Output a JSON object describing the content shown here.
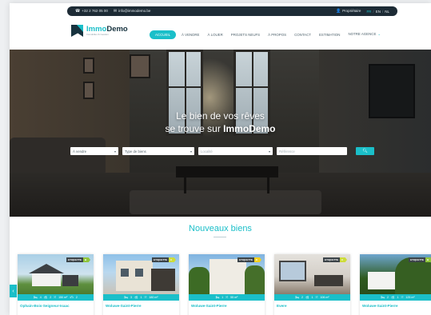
{
  "topbar": {
    "phone": "+32 2 762 05 00",
    "email": "info@immodemo.be",
    "owners": "Propriétaire",
    "langs": [
      {
        "code": "FR",
        "active": true
      },
      {
        "code": "EN",
        "active": false
      },
      {
        "code": "NL",
        "active": false
      }
    ],
    "lang_sep": "/"
  },
  "logo": {
    "name_part1": "Immo",
    "name_part2": "Demo",
    "tagline": "Immobilier & Gestion"
  },
  "nav": {
    "items": [
      {
        "label": "Accueil",
        "active": true
      },
      {
        "label": "À vendre"
      },
      {
        "label": "À louer"
      },
      {
        "label": "Projets neufs"
      },
      {
        "label": "À propos"
      },
      {
        "label": "Contact"
      },
      {
        "label": "Estimation"
      },
      {
        "label": "Notre agence"
      }
    ]
  },
  "hero": {
    "line1": "Le bien de vos rêves",
    "line2_prefix": "se trouve sur ",
    "line2_brand": "ImmoDemo"
  },
  "search": {
    "transaction": "À vendre",
    "type": "Type de biens",
    "location": "Localité",
    "reference": "Référence",
    "button_icon": "search-icon"
  },
  "listings": {
    "title": "Nouveaux biens",
    "cards": [
      {
        "city": "Ophain-Bois-Seigneur-Isaac",
        "beds": "4",
        "baths": "2",
        "area": "150 m²",
        "garage": "2",
        "epc": "B"
      },
      {
        "city": "Woluwe-Saint-Pierre",
        "beds": "3",
        "baths": "1",
        "area": "180 m²",
        "epc": "C"
      },
      {
        "city": "Woluwe-Saint-Pierre",
        "beds": "1",
        "area": "55 m²",
        "epc": "D"
      },
      {
        "city": "Evere",
        "beds": "2",
        "baths": "1",
        "area": "106 m²",
        "epc": "C"
      },
      {
        "city": "Woluwe-Saint-Pierre",
        "beds": "2",
        "baths": "1",
        "area": "125 m²",
        "epc": "B"
      }
    ]
  },
  "colors": {
    "accent": "#1bbfc9",
    "dark": "#1d2b35",
    "epc_B": "#8fc43b",
    "epc_C": "#cddc3a",
    "epc_D": "#f2d020"
  }
}
